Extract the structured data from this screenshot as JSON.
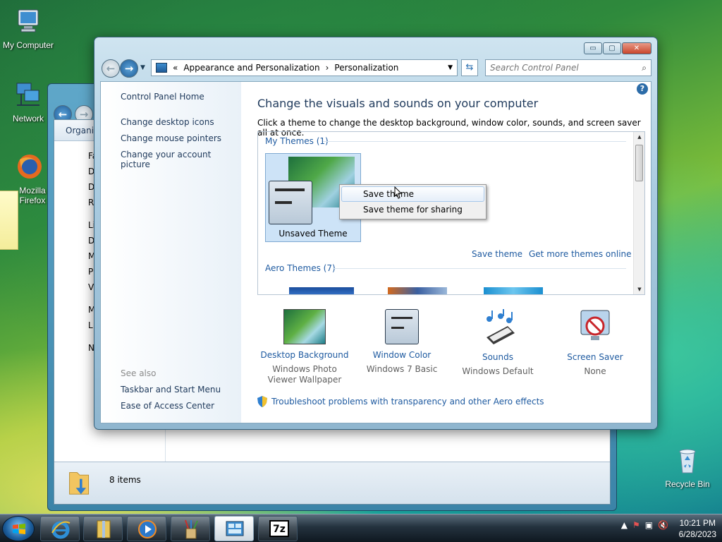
{
  "desktop": {
    "icons": [
      {
        "label": "My Computer"
      },
      {
        "label": "Network"
      },
      {
        "label": "Mozilla Firefox"
      },
      {
        "label": "Recycle Bin"
      }
    ]
  },
  "background_window": {
    "toolbar_label": "Organize",
    "nav_items": [
      "Fav",
      "D",
      "D",
      "R",
      "Lib",
      "D",
      "M",
      "P",
      "V",
      "My",
      "L",
      "Net"
    ],
    "status_text": "8 items"
  },
  "window": {
    "controls": {
      "minimize": "▭",
      "maximize": "▢",
      "close": "✕"
    },
    "address": {
      "prefix": "«",
      "crumbs": [
        "Appearance and Personalization",
        "Personalization"
      ],
      "separator": "›"
    },
    "search_placeholder": "Search Control Panel",
    "left_pane": {
      "home_link": "Control Panel Home",
      "links": [
        "Change desktop icons",
        "Change mouse pointers",
        "Change your account picture"
      ],
      "see_also_title": "See also",
      "see_also_links": [
        "Taskbar and Start Menu",
        "Ease of Access Center"
      ]
    },
    "main": {
      "heading": "Change the visuals and sounds on your computer",
      "subtext": "Click a theme to change the desktop background, window color, sounds, and screen saver all at once.",
      "my_themes_header": "My Themes (1)",
      "unsaved_theme_label": "Unsaved Theme",
      "save_theme_link": "Save theme",
      "get_more_link": "Get more themes online",
      "aero_themes_header": "Aero Themes (7)",
      "bottom_items": [
        {
          "title": "Desktop Background",
          "subtitle": "Windows Photo Viewer Wallpaper"
        },
        {
          "title": "Window Color",
          "subtitle": "Windows 7 Basic"
        },
        {
          "title": "Sounds",
          "subtitle": "Windows Default"
        },
        {
          "title": "Screen Saver",
          "subtitle": "None"
        }
      ],
      "troubleshoot_link": "Troubleshoot problems with transparency and other Aero effects"
    }
  },
  "context_menu": {
    "items": [
      "Save theme",
      "Save theme for sharing"
    ],
    "highlighted_index": 0
  },
  "taskbar": {
    "apps": [
      "internet-explorer",
      "file-archive",
      "media-player",
      "paint-tools",
      "control-panel",
      "7zip"
    ],
    "active_app": "control-panel",
    "sevenzip_label": "7z",
    "clock": {
      "time": "10:21 PM",
      "date": "6/28/2023"
    }
  },
  "colors": {
    "link_blue": "#1e5aa0",
    "heading_blue": "#1e395b",
    "selection_blue": "#cde3f7"
  }
}
